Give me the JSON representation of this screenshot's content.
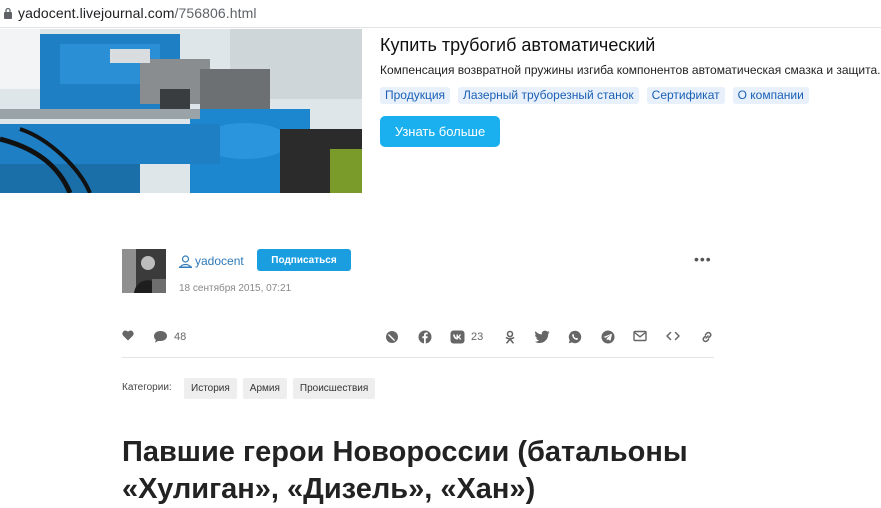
{
  "browser": {
    "url_host": "yadocent.livejournal.com",
    "url_path": "/756806.html"
  },
  "ad": {
    "title": "Купить трубогиб автоматический",
    "description": "Компенсация возвратной пружины изгиба компонентов автоматическая смазка и защита.",
    "tags": [
      "Продукция",
      "Лазерный труборезный станок",
      "Сертификат",
      "О компании"
    ],
    "button": "Узнать больше"
  },
  "author": {
    "username": "yadocent",
    "subscribe": "Подписаться",
    "date": "18 сентября 2015, 07:21",
    "more": "•••"
  },
  "actions": {
    "comments_count": "48",
    "vk_count": "23"
  },
  "categories": {
    "label": "Категории:",
    "items": [
      "История",
      "Армия",
      "Происшествия"
    ]
  },
  "post": {
    "title": "Павшие герои Новороссии (батальоны «Хулиган», «Дизель», «Хан»)"
  }
}
